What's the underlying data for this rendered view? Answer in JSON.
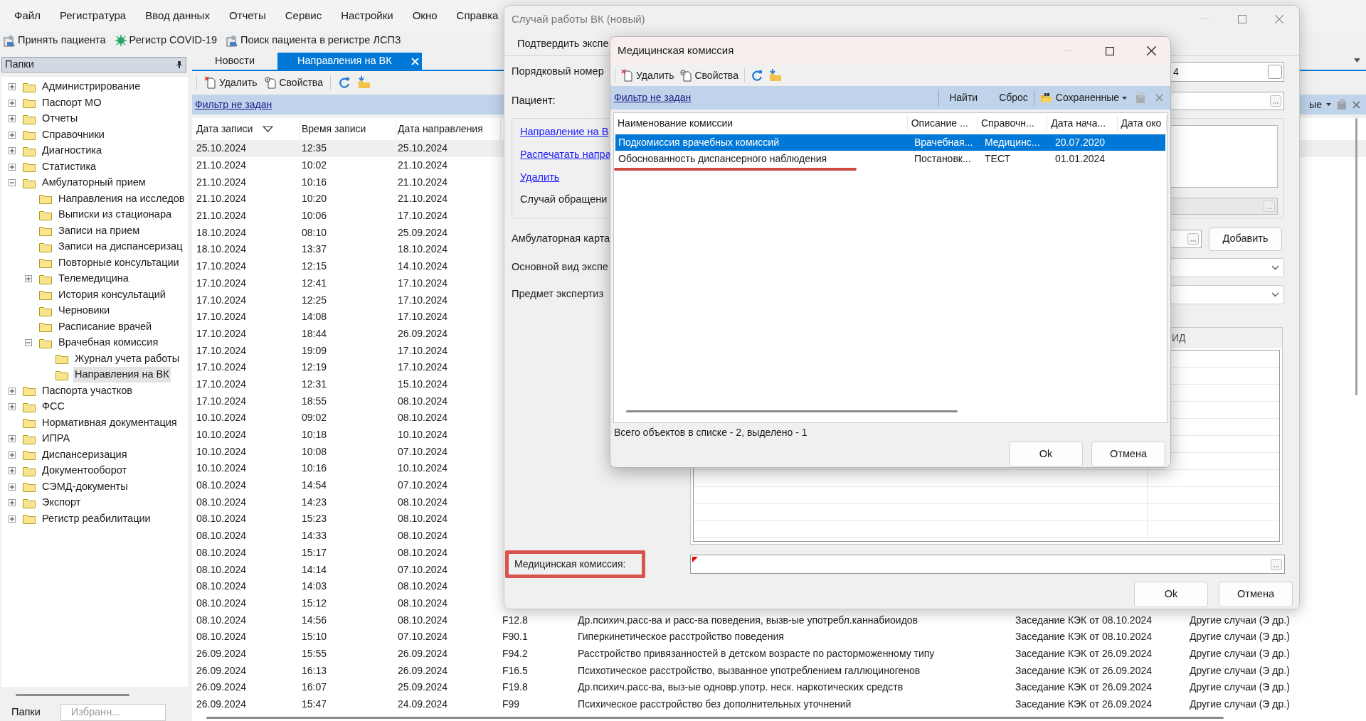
{
  "menu": [
    "Файл",
    "Регистратура",
    "Ввод данных",
    "Отчеты",
    "Сервис",
    "Настройки",
    "Окно",
    "Справка"
  ],
  "toolbar": [
    {
      "label": "Принять пациента",
      "kind": "person"
    },
    {
      "label": "Регистр COVID-19",
      "kind": "virus"
    },
    {
      "label": "Поиск пациента в регистре ЛСПЗ",
      "kind": "person"
    }
  ],
  "sidebar": {
    "title": "Папки",
    "tree": [
      {
        "label": "Администрирование",
        "expanded": false,
        "selected": false
      },
      {
        "label": "Паспорт МО",
        "expanded": false,
        "selected": false
      },
      {
        "label": "Отчеты",
        "expanded": false,
        "selected": false
      },
      {
        "label": "Справочники",
        "expanded": false,
        "selected": false
      },
      {
        "label": "Диагностика",
        "expanded": false,
        "selected": false
      },
      {
        "label": "Статистика",
        "expanded": false,
        "selected": false
      },
      {
        "label": "Амбулаторный прием",
        "expanded": true,
        "selected": false,
        "children": [
          {
            "label": "Направления на исследов",
            "selected": false
          },
          {
            "label": "Выписки из стационара",
            "selected": false
          },
          {
            "label": "Записи на прием",
            "selected": false
          },
          {
            "label": "Записи на диспансеризац",
            "selected": false
          },
          {
            "label": "Повторные консультации",
            "selected": false
          },
          {
            "label": "Телемедицина",
            "expanded": false,
            "selected": false
          },
          {
            "label": "История консультаций",
            "selected": false
          },
          {
            "label": "Черновики",
            "selected": false
          },
          {
            "label": "Расписание врачей",
            "selected": false
          },
          {
            "label": "Врачебная комиссия",
            "expanded": true,
            "selected": false,
            "children": [
              {
                "label": "Журнал учета работы",
                "selected": false
              },
              {
                "label": "Направления на ВК",
                "selected": true
              }
            ]
          }
        ]
      },
      {
        "label": "Паспорта участков",
        "expanded": false,
        "selected": false
      },
      {
        "label": "ФСС",
        "expanded": false,
        "selected": false
      },
      {
        "label": "Нормативная документация",
        "selected": false
      },
      {
        "label": "ИПРА",
        "expanded": false,
        "selected": false
      },
      {
        "label": "Диспансеризация",
        "expanded": false,
        "selected": false
      },
      {
        "label": "Документооборот",
        "expanded": false,
        "selected": false
      },
      {
        "label": "СЭМД-документы",
        "expanded": false,
        "selected": false
      },
      {
        "label": "Экспорт",
        "expanded": false,
        "selected": false
      },
      {
        "label": "Регистр реабилитации",
        "expanded": false,
        "selected": false
      }
    ],
    "bottom_tabs": [
      {
        "label": "Папки",
        "selected": true
      },
      {
        "label": "Избранн...",
        "selected": false
      }
    ]
  },
  "tabs": [
    {
      "label": "Новости",
      "selected": false
    },
    {
      "label": "Направления на ВК",
      "selected": true
    }
  ],
  "main": {
    "toolbar": [
      "Удалить",
      "Свойства"
    ],
    "filter": "Фильтр не задан",
    "saved": "ые",
    "columns": [
      {
        "label": "Дата записи",
        "sorted": true
      },
      {
        "label": "Время записи",
        "sorted": false
      },
      {
        "label": "Дата направления",
        "sorted": false
      }
    ],
    "rows": [
      {
        "cells": [
          "25.10.2024",
          "12:35",
          "25.10.2024"
        ],
        "selected": true
      },
      {
        "cells": [
          "21.10.2024",
          "10:02",
          "21.10.2024"
        ],
        "selected": false
      },
      {
        "cells": [
          "21.10.2024",
          "10:16",
          "21.10.2024"
        ],
        "selected": false
      },
      {
        "cells": [
          "21.10.2024",
          "10:20",
          "21.10.2024"
        ],
        "selected": false
      },
      {
        "cells": [
          "21.10.2024",
          "10:06",
          "17.10.2024"
        ],
        "selected": false
      },
      {
        "cells": [
          "18.10.2024",
          "08:10",
          "25.09.2024"
        ],
        "selected": false
      },
      {
        "cells": [
          "18.10.2024",
          "13:37",
          "18.10.2024"
        ],
        "selected": false
      },
      {
        "cells": [
          "17.10.2024",
          "12:15",
          "14.10.2024"
        ],
        "selected": false
      },
      {
        "cells": [
          "17.10.2024",
          "12:41",
          "17.10.2024"
        ],
        "selected": false
      },
      {
        "cells": [
          "17.10.2024",
          "12:25",
          "17.10.2024"
        ],
        "selected": false
      },
      {
        "cells": [
          "17.10.2024",
          "14:08",
          "17.10.2024"
        ],
        "selected": false
      },
      {
        "cells": [
          "17.10.2024",
          "18:44",
          "26.09.2024"
        ],
        "selected": false
      },
      {
        "cells": [
          "17.10.2024",
          "19:09",
          "17.10.2024"
        ],
        "selected": false
      },
      {
        "cells": [
          "17.10.2024",
          "12:19",
          "17.10.2024"
        ],
        "selected": false
      },
      {
        "cells": [
          "17.10.2024",
          "12:31",
          "15.10.2024"
        ],
        "selected": false
      },
      {
        "cells": [
          "17.10.2024",
          "18:55",
          "08.10.2024"
        ],
        "selected": false
      },
      {
        "cells": [
          "10.10.2024",
          "09:02",
          "08.10.2024"
        ],
        "selected": false
      },
      {
        "cells": [
          "10.10.2024",
          "10:18",
          "10.10.2024"
        ],
        "selected": false
      },
      {
        "cells": [
          "10.10.2024",
          "10:08",
          "07.10.2024"
        ],
        "selected": false
      },
      {
        "cells": [
          "10.10.2024",
          "10:16",
          "10.10.2024"
        ],
        "selected": false
      },
      {
        "cells": [
          "08.10.2024",
          "14:54",
          "07.10.2024"
        ],
        "selected": false
      },
      {
        "cells": [
          "08.10.2024",
          "14:23",
          "08.10.2024"
        ],
        "selected": false
      },
      {
        "cells": [
          "08.10.2024",
          "15:23",
          "08.10.2024"
        ],
        "selected": false
      },
      {
        "cells": [
          "08.10.2024",
          "14:33",
          "08.10.2024"
        ],
        "selected": false
      },
      {
        "cells": [
          "08.10.2024",
          "15:17",
          "08.10.2024"
        ],
        "selected": false
      },
      {
        "cells": [
          "08.10.2024",
          "14:14",
          "07.10.2024"
        ],
        "selected": false
      },
      {
        "cells": [
          "08.10.2024",
          "14:03",
          "08.10.2024"
        ],
        "selected": false
      },
      {
        "cells": [
          "08.10.2024",
          "15:12",
          "08.10.2024"
        ],
        "selected": false
      },
      {
        "cells": [
          "08.10.2024",
          "14:56",
          "08.10.2024",
          "F12.8",
          "Др.психич.расс-ва и расс-ва поведения, вызв-ые употребл.каннабиоидов",
          "Заседание КЭК от 08.10.2024",
          "Другие случаи (Э др.)"
        ],
        "selected": false
      },
      {
        "cells": [
          "08.10.2024",
          "15:10",
          "07.10.2024",
          "F90.1",
          "Гиперкинетическое расстройство поведения",
          "Заседание КЭК от 08.10.2024",
          "Другие случаи (Э др.)"
        ],
        "selected": false
      },
      {
        "cells": [
          "26.09.2024",
          "15:55",
          "26.09.2024",
          "F94.2",
          "Расстройство привязанностей в детском возрасте по расторможенному типу",
          "Заседание КЭК от 26.09.2024",
          "Другие случаи (Э др.)"
        ],
        "selected": false
      },
      {
        "cells": [
          "26.09.2024",
          "16:13",
          "26.09.2024",
          "F16.5",
          "Психотическое расстройство, вызванное употреблением галлюциногенов",
          "Заседание КЭК от 26.09.2024",
          "Другие случаи (Э др.)"
        ],
        "selected": false
      },
      {
        "cells": [
          "26.09.2024",
          "16:07",
          "25.09.2024",
          "F19.8",
          "Др.психич.расс-ва, выз-ые одновр.употр. неск. наркотических средств",
          "Заседание КЭК от 26.09.2024",
          "Другие случаи (Э др.)"
        ],
        "selected": false
      },
      {
        "cells": [
          "26.09.2024",
          "15:47",
          "24.09.2024",
          "F99",
          "Психическое расстройство без дополнительных уточнений",
          "Заседание КЭК от 26.09.2024",
          "Другие случаи (Э др.)"
        ],
        "selected": false
      }
    ]
  },
  "case_dialog": {
    "title": "Случай работы ВК (новый)",
    "toolbar_button": "Подтвердить экспе",
    "number_label": "Порядковый номер",
    "number_value": "4",
    "number_checkbox": {
      "checked": false
    },
    "patient_label": "Пациент:",
    "links": [
      "Направление на В",
      "Распечатать напра",
      "Удалить"
    ],
    "case_label": "Случай обращени",
    "card_label": "Амбулаторная карта",
    "add_button": "Добавить",
    "expertise_label": "Основной вид экспе",
    "subject_label": "Предмет экспертиз",
    "grid_column": "ИД",
    "commission_label": "Медицинская комиссия:",
    "commission_highlighted": true,
    "commission_required": true,
    "buttons": [
      "Ok",
      "Отмена"
    ]
  },
  "commission_dialog": {
    "title": "Медицинская комиссия",
    "toolbar": [
      "Удалить",
      "Свойства"
    ],
    "filter": "Фильтр не задан",
    "find": "Найти",
    "reset": "Сброс",
    "saved": "Сохраненные",
    "columns": [
      "Наименование комиссии",
      "Описание ...",
      "Справочн...",
      "Дата нача...",
      "Дата око"
    ],
    "rows": [
      {
        "cells": [
          "Подкомиссия врачебных комиссий",
          "Врачебная...",
          "Медицинс...",
          "20.07.2020"
        ],
        "selected": true,
        "underlined": false
      },
      {
        "cells": [
          "Обоснованность диспансерного наблюдения",
          "Постановк...",
          "ТЕСТ",
          "01.01.2024"
        ],
        "selected": false,
        "underlined": true
      }
    ],
    "status": "Всего объектов в списке - 2, выделено - 1",
    "buttons": [
      "Ok",
      "Отмена"
    ]
  }
}
